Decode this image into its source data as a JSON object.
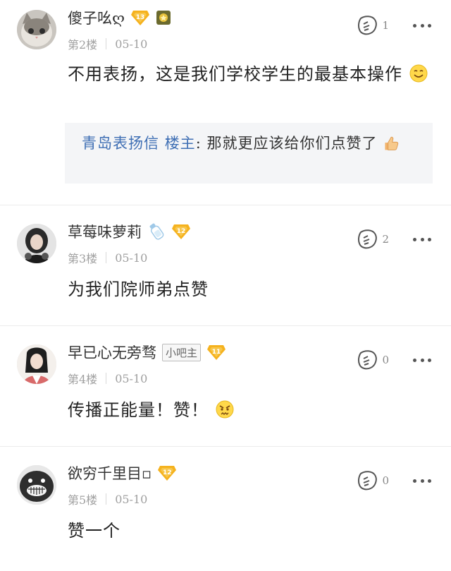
{
  "posts": [
    {
      "username": "傻子吆ღ",
      "level": "13",
      "floor": "第2楼",
      "date": "05-10",
      "likes": "1",
      "content": "不用表扬，这是我们学校学生的最基本操作",
      "reply": {
        "author": "青岛表扬信",
        "role": "楼主",
        "colon": ":",
        "text": "那就更应该给你们点赞了"
      }
    },
    {
      "username": "草莓味萝莉",
      "level": "12",
      "floor": "第3楼",
      "date": "05-10",
      "likes": "2",
      "content": "为我们院师弟点赞"
    },
    {
      "username": "早已心无旁骛",
      "tag": "小吧主",
      "level": "11",
      "floor": "第4楼",
      "date": "05-10",
      "likes": "0",
      "content": "传播正能量！赞！"
    },
    {
      "username": "欲穷千里目▫",
      "level": "12",
      "floor": "第5楼",
      "date": "05-10",
      "likes": "0",
      "content": "赞一个"
    }
  ],
  "colors": {
    "badge": "#f5b21e",
    "reply_author": "#3f6fb4",
    "reply_bg": "#f4f5f7"
  },
  "icons": [
    "avatar",
    "level-badge-icon",
    "medal-icon",
    "bottle-icon",
    "like-icon",
    "more-icon",
    "smile-emoji",
    "thumbs-up-emoji",
    "angry-emoji"
  ]
}
